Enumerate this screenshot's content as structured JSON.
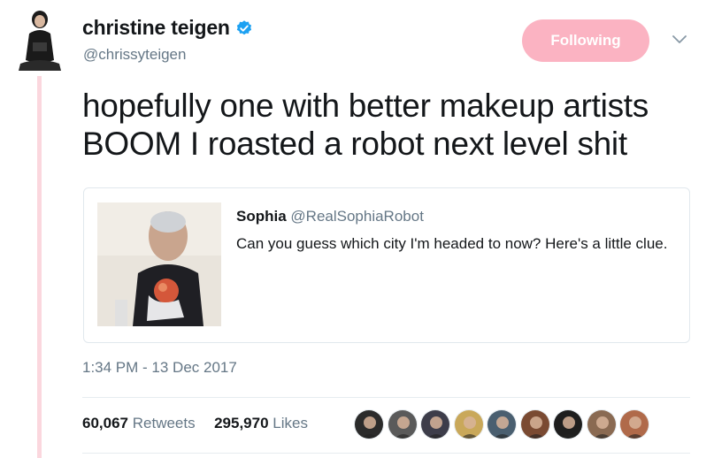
{
  "author": {
    "name": "christine teigen",
    "handle": "@chrissyteigen",
    "verified": true
  },
  "follow_button": {
    "label": "Following",
    "color": "#fbb3c2"
  },
  "tweet": {
    "lines": [
      "hopefully one with better makeup artists",
      "BOOM I roasted a robot next level shit"
    ],
    "timestamp": "1:34 PM - 13 Dec 2017"
  },
  "quoted_tweet": {
    "name": "Sophia",
    "handle": "@RealSophiaRobot",
    "text": "Can you guess which city I'm headed to now? Here's a little clue."
  },
  "stats": {
    "retweets_count": "60,067",
    "retweets_label": "Retweets",
    "likes_count": "295,970",
    "likes_label": "Likes"
  },
  "likers": [
    {
      "name": "liker-avatar-1",
      "color": "#2b2b2b"
    },
    {
      "name": "liker-avatar-2",
      "color": "#5a5a5a"
    },
    {
      "name": "liker-avatar-3",
      "color": "#3d3d4a"
    },
    {
      "name": "liker-avatar-4",
      "color": "#c9a85a"
    },
    {
      "name": "liker-avatar-5",
      "color": "#4a5f70"
    },
    {
      "name": "liker-avatar-6",
      "color": "#7a4a32"
    },
    {
      "name": "liker-avatar-7",
      "color": "#1e1e1e"
    },
    {
      "name": "liker-avatar-8",
      "color": "#8a6a52"
    },
    {
      "name": "liker-avatar-9",
      "color": "#b06a4a"
    }
  ],
  "colors": {
    "thread_line": "#fbd7de",
    "secondary_text": "#657786",
    "verified_blue": "#1da1f2"
  }
}
